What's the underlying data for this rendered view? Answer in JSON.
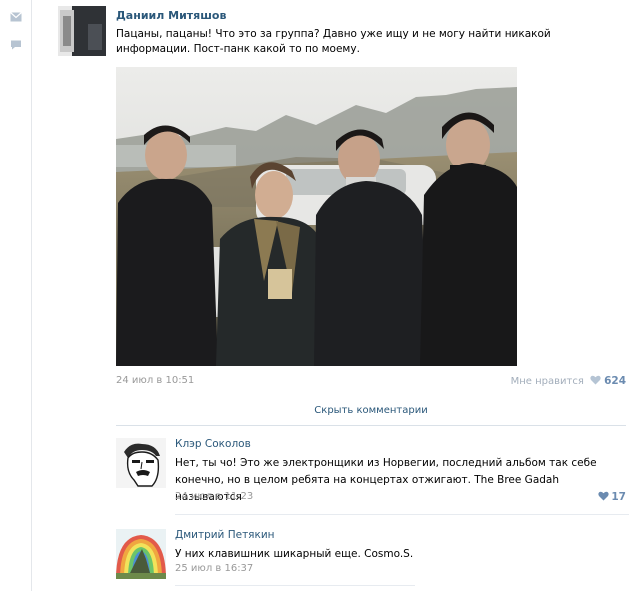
{
  "post": {
    "author": "Даниил Митяшов",
    "text": "Пацаны, пацаны! Что это за группа? Давно уже ищу и не могу найти никакой информации. Пост-панк какой то по моему.",
    "date": "24 июл в 10:51",
    "like_label": "Мне нравится",
    "like_count": "624"
  },
  "hide_comments_label": "Скрыть комментарии",
  "comments": [
    {
      "author": "Клэр Соколов",
      "text": "Нет, ты чо! Это же электронщики из Норвегии, последний альбом так себе конечно, но в целом ребята на концертах отжигают. The Bree Gadah называются",
      "date": "24 июл в 11:23",
      "likes": "17"
    },
    {
      "author": "Дмитрий Петякин",
      "text": "У них клавишник шикарный еще. Cosmo.S.",
      "date": "25 июл в 16:37"
    }
  ],
  "icons": {
    "rail": [
      "mail-icon",
      "chat-icon"
    ],
    "like": "heart-icon"
  },
  "colors": {
    "link": "#2b587a",
    "meta": "#999999",
    "like": "#6b8bb0"
  }
}
